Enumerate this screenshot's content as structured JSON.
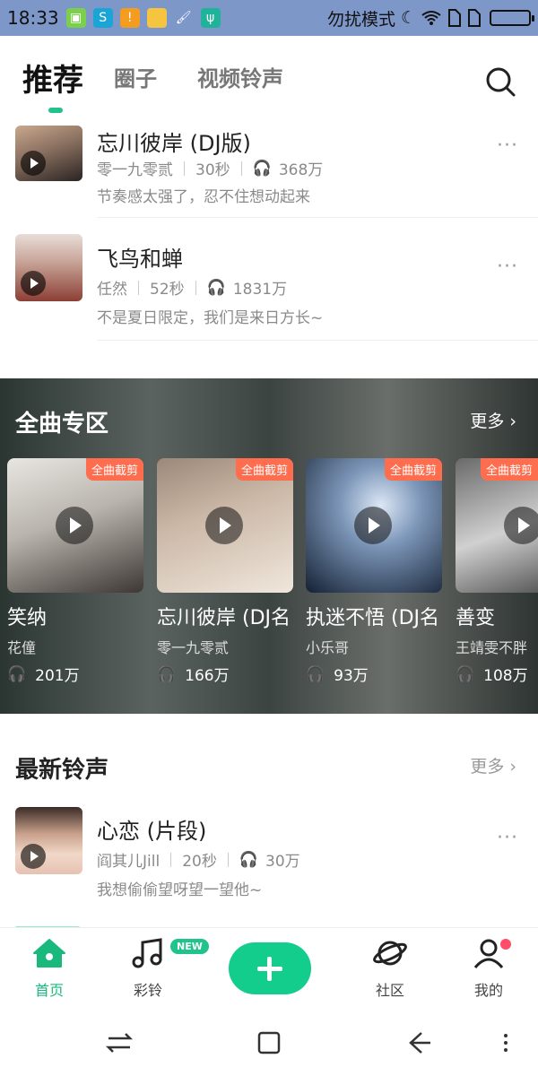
{
  "status_bar": {
    "time": "18:33",
    "dnd_label": "勿扰模式",
    "app_icons": [
      "shopping-bag-icon",
      "skype-icon",
      "warning-icon",
      "folder-icon",
      "brush-icon",
      "usb-icon"
    ]
  },
  "header": {
    "tabs": [
      {
        "label": "推荐",
        "active": true
      },
      {
        "label": "圈子",
        "active": false
      },
      {
        "label": "视频铃声",
        "active": false
      }
    ],
    "accent": "#23c28d"
  },
  "recommend_list": [
    {
      "title": "忘川彼岸 (DJ版)",
      "artist": "零一九零贰",
      "duration": "30秒",
      "plays": "368万",
      "desc": "节奏感太强了，忍不住想动起来"
    },
    {
      "title": "飞鸟和蝉",
      "artist": "任然",
      "duration": "52秒",
      "plays": "1831万",
      "desc": "不是夏日限定，我们是来日方长~"
    }
  ],
  "full_song_zone": {
    "title": "全曲专区",
    "more_label": "更多",
    "badge_label": "全曲截剪",
    "cards": [
      {
        "title": "笑纳",
        "artist": "花僮",
        "plays": "201万"
      },
      {
        "title": "忘川彼岸 (DJ名",
        "artist": "零一九零贰",
        "plays": "166万"
      },
      {
        "title": "执迷不悟 (DJ名",
        "artist": "小乐哥",
        "plays": "93万"
      },
      {
        "title": "善变",
        "artist": "王靖雯不胖",
        "plays": "108万"
      }
    ]
  },
  "newest": {
    "title": "最新铃声",
    "more_label": "更多",
    "items": [
      {
        "title": "心恋 (片段)",
        "artist": "阎其儿Jill",
        "duration": "20秒",
        "plays": "30万",
        "desc": "我想偷偷望呀望一望他~"
      }
    ]
  },
  "bottom_nav": {
    "home": "首页",
    "ringtone": "彩铃",
    "new_badge": "NEW",
    "community": "社区",
    "mine": "我的",
    "active_color": "#19b97d"
  }
}
